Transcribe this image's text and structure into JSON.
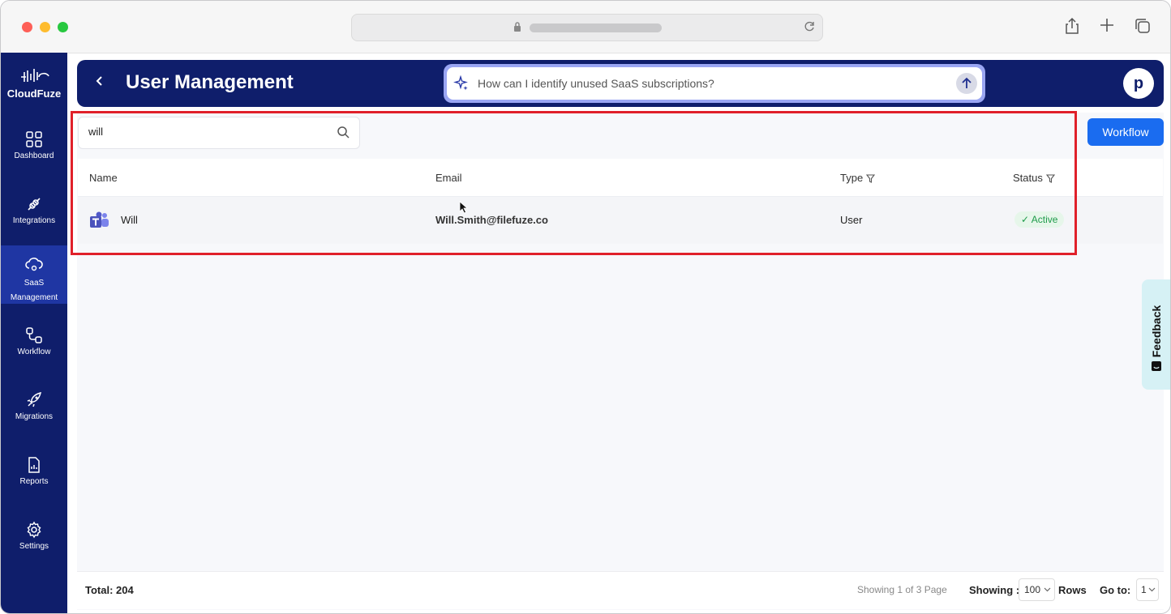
{
  "sidebar": {
    "logo": "CloudFuze",
    "items": [
      {
        "label": "Dashboard",
        "icon": "dashboard-icon"
      },
      {
        "label": "Integrations",
        "icon": "plug-icon"
      },
      {
        "label": "SaaS Management",
        "icon": "cloud-gear-icon",
        "active": true
      },
      {
        "label": "Workflow",
        "icon": "workflow-icon"
      },
      {
        "label": "Migrations",
        "icon": "rocket-icon"
      },
      {
        "label": "Reports",
        "icon": "report-icon"
      },
      {
        "label": "Settings",
        "icon": "gear-icon"
      }
    ]
  },
  "header": {
    "title": "User Management",
    "ai_placeholder": "How can I identify unused SaaS subscriptions?",
    "avatar_initial": "p"
  },
  "toolbar": {
    "search_value": "will",
    "workflow_label": "Workflow"
  },
  "table": {
    "columns": [
      "Name",
      "Email",
      "Type",
      "Status"
    ],
    "rows": [
      {
        "name": "Will",
        "email": "Will.Smith@filefuze.co",
        "type": "User",
        "status": "Active",
        "app_icon": "teams-icon"
      }
    ]
  },
  "footer": {
    "total": "Total: 204",
    "page_info": "Showing 1 of 3 Page",
    "showing_label": "Showing :",
    "rows_per_page": "100",
    "rows_label": "Rows",
    "goto_label": "Go to:",
    "goto_value": "1"
  },
  "feedback": {
    "label": "Feedback"
  },
  "colors": {
    "brand": "#0f1e6b",
    "accent": "#1a6cf0",
    "highlight": "#e0202a",
    "active_status": "#1e9b4a"
  }
}
